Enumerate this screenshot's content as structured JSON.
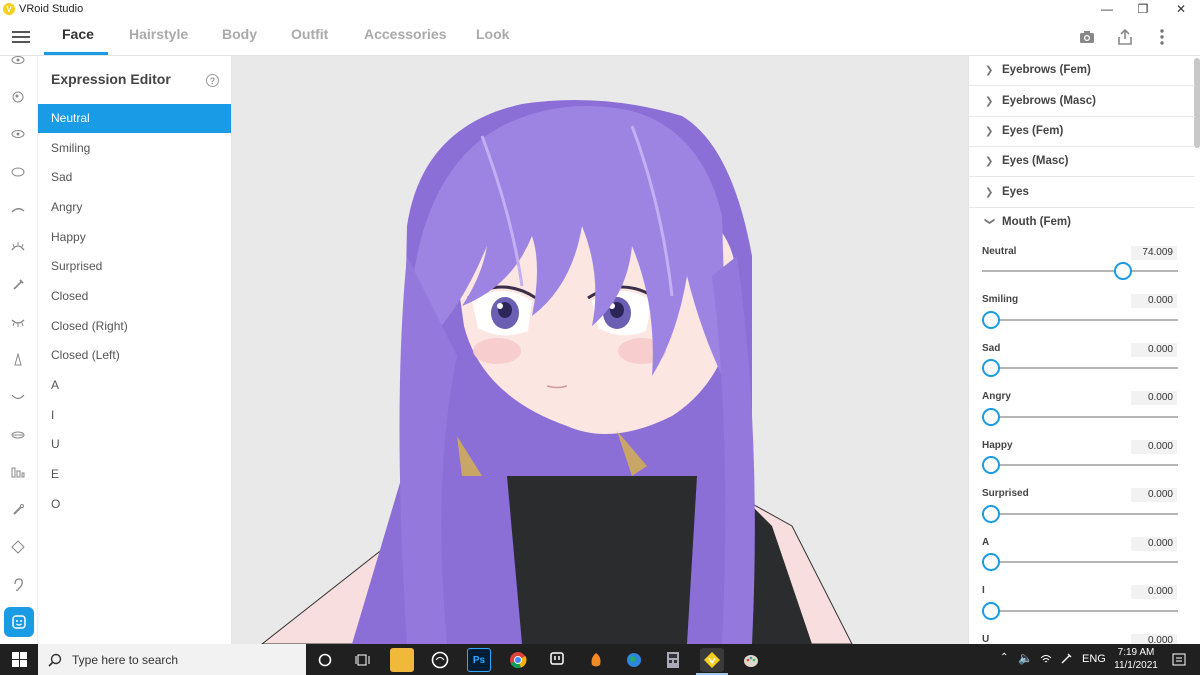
{
  "window": {
    "title": "VRoid Studio"
  },
  "nav": {
    "tabs": [
      {
        "label": "Face"
      },
      {
        "label": "Hairstyle"
      },
      {
        "label": "Body"
      },
      {
        "label": "Outfit"
      },
      {
        "label": "Accessories"
      },
      {
        "label": "Look"
      }
    ],
    "active_tab": "Face"
  },
  "expression_editor": {
    "title": "Expression Editor",
    "help": "?",
    "items": [
      {
        "label": "Neutral"
      },
      {
        "label": "Smiling"
      },
      {
        "label": "Sad"
      },
      {
        "label": "Angry"
      },
      {
        "label": "Happy"
      },
      {
        "label": "Surprised"
      },
      {
        "label": "Closed"
      },
      {
        "label": "Closed (Right)"
      },
      {
        "label": "Closed (Left)"
      },
      {
        "label": "A"
      },
      {
        "label": "I"
      },
      {
        "label": "U"
      },
      {
        "label": "E"
      },
      {
        "label": "O"
      }
    ],
    "selected": "Neutral"
  },
  "right_panel": {
    "sections": [
      {
        "label": "Eyebrows (Fem)",
        "expanded": false
      },
      {
        "label": "Eyebrows (Masc)",
        "expanded": false
      },
      {
        "label": "Eyes (Fem)",
        "expanded": false
      },
      {
        "label": "Eyes (Masc)",
        "expanded": false
      },
      {
        "label": "Eyes",
        "expanded": false
      },
      {
        "label": "Mouth (Fem)",
        "expanded": true
      }
    ],
    "sliders": [
      {
        "label": "Neutral",
        "value": "74.009",
        "fraction": 0.74
      },
      {
        "label": "Smiling",
        "value": "0.000",
        "fraction": 0
      },
      {
        "label": "Sad",
        "value": "0.000",
        "fraction": 0
      },
      {
        "label": "Angry",
        "value": "0.000",
        "fraction": 0
      },
      {
        "label": "Happy",
        "value": "0.000",
        "fraction": 0
      },
      {
        "label": "Surprised",
        "value": "0.000",
        "fraction": 0
      },
      {
        "label": "A",
        "value": "0.000",
        "fraction": 0
      },
      {
        "label": "I",
        "value": "0.000",
        "fraction": 0
      },
      {
        "label": "U",
        "value": "0.000",
        "fraction": 0
      }
    ]
  },
  "taskbar": {
    "search_placeholder": "Type here to search",
    "apps": [
      "cortana-icon",
      "task-view-icon",
      "file-explorer-icon",
      "line-icon",
      "photoshop-icon",
      "chrome-icon",
      "twitch-icon",
      "fl-studio-icon",
      "earth-icon",
      "calculator-icon",
      "vroid-icon",
      "paint-icon"
    ],
    "photoshop_label": "Ps",
    "language": "ENG",
    "time": "7:19 AM",
    "date": "11/1/2021"
  },
  "colors": {
    "accent": "#1a9be6",
    "hair": "#9b7fe0",
    "viewport_bg": "#e9e9e9"
  }
}
